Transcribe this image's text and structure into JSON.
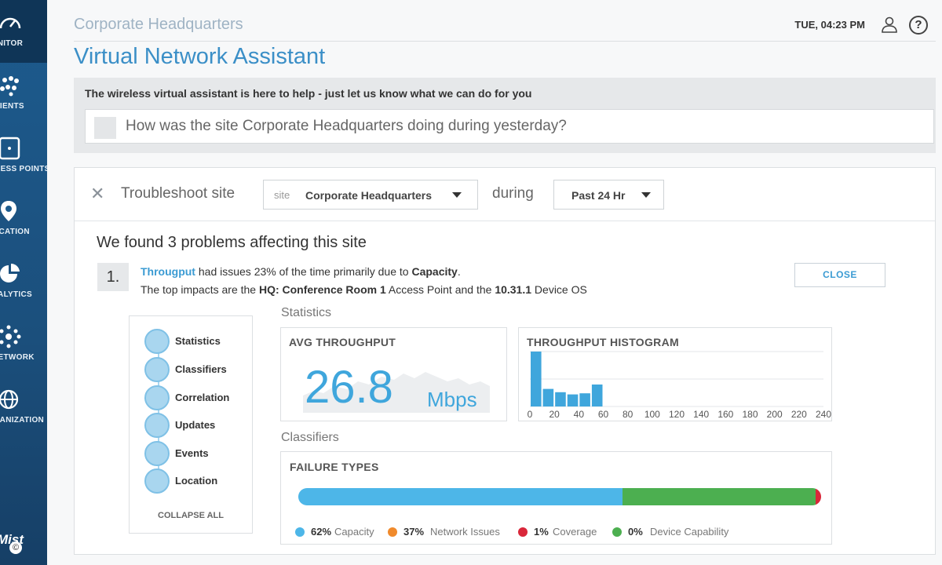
{
  "sidebar": {
    "items": [
      {
        "label": "MONITOR",
        "icon": "speedometer-icon",
        "active": true
      },
      {
        "label": "CLIENTS",
        "icon": "clients-icon"
      },
      {
        "label": "ACCESS POINTS",
        "icon": "access-point-icon"
      },
      {
        "label": "LOCATION",
        "icon": "location-pin-icon"
      },
      {
        "label": "ANALYTICS",
        "icon": "pie-chart-icon"
      },
      {
        "label": "NETWORK",
        "icon": "network-icon"
      },
      {
        "label": "ORGANIZATION",
        "icon": "globe-icon"
      }
    ],
    "brand": {
      "logo_text": "Mist",
      "copyright": "©"
    }
  },
  "header": {
    "site": "Corporate Headquarters",
    "datetime": "TUE, 04:23 PM",
    "help_symbol": "?"
  },
  "page_title": "Virtual Network Assistant",
  "assistant": {
    "intro": "The wireless virtual assistant is here to help - just let us know what we can do for you",
    "query": "How was the site Corporate Headquarters doing during yesterday?"
  },
  "troubleshoot": {
    "dismiss_symbol": "✕",
    "label": "Troubleshoot site",
    "site_prefix": "site",
    "site_value": "Corporate Headquarters",
    "during_label": "during",
    "time_value": "Past 24 Hr"
  },
  "problems": {
    "heading": "We found 3 problems affecting this site",
    "first": {
      "number": "1.",
      "metric": "Througput",
      "text_a": " had issues 23% of the time primarily due to ",
      "cause": "Capacity",
      "text_b": ".",
      "line2_a": "The top impacts are the ",
      "impact_ap": "HQ: Conference Room 1",
      "line2_b": " Access Point and the ",
      "impact_os": "10.31.1",
      "line2_c": " Device OS"
    },
    "close_label": "CLOSE"
  },
  "steps": {
    "items": [
      "Statistics",
      "Classifiers",
      "Correlation",
      "Updates",
      "Events",
      "Location"
    ],
    "collapse_label": "COLLAPSE ALL"
  },
  "statistics": {
    "label": "Statistics",
    "avg_title": "AVG THROUGHPUT",
    "avg_value": "26.8",
    "avg_unit": "Mbps",
    "hist_title": "THROUGHPUT HISTOGRAM"
  },
  "chart_data": {
    "type": "bar",
    "title": "THROUGHPUT HISTOGRAM",
    "x_ticks": [
      0,
      20,
      40,
      60,
      80,
      100,
      120,
      140,
      160,
      180,
      200,
      220,
      240
    ],
    "bins": [
      {
        "start": 0,
        "end": 10,
        "value": 100
      },
      {
        "start": 10,
        "end": 20,
        "value": 32
      },
      {
        "start": 20,
        "end": 30,
        "value": 26
      },
      {
        "start": 30,
        "end": 40,
        "value": 22
      },
      {
        "start": 40,
        "end": 50,
        "value": 24
      },
      {
        "start": 50,
        "end": 60,
        "value": 40
      }
    ],
    "xlim": [
      0,
      240
    ],
    "ylim": [
      0,
      100
    ],
    "grid": true
  },
  "classifiers": {
    "label": "Classifiers",
    "title": "FAILURE TYPES",
    "segments": [
      {
        "pct_label": "62%",
        "name": "Capacity",
        "share": 62,
        "color": "#4db6e8"
      },
      {
        "pct_label": "37%",
        "name": "Network Issues",
        "share": 37,
        "color": "#4caf50",
        "legend_color": "#f08a2c"
      },
      {
        "pct_label": "1%",
        "name": "Coverage",
        "share": 1,
        "color": "#d9273a"
      },
      {
        "pct_label": "0%",
        "name": "Device Capability",
        "share": 0,
        "color": "#4caf50"
      }
    ]
  },
  "colors": {
    "accent": "#3b9bd3",
    "sidebar": "#1d5b8e"
  }
}
